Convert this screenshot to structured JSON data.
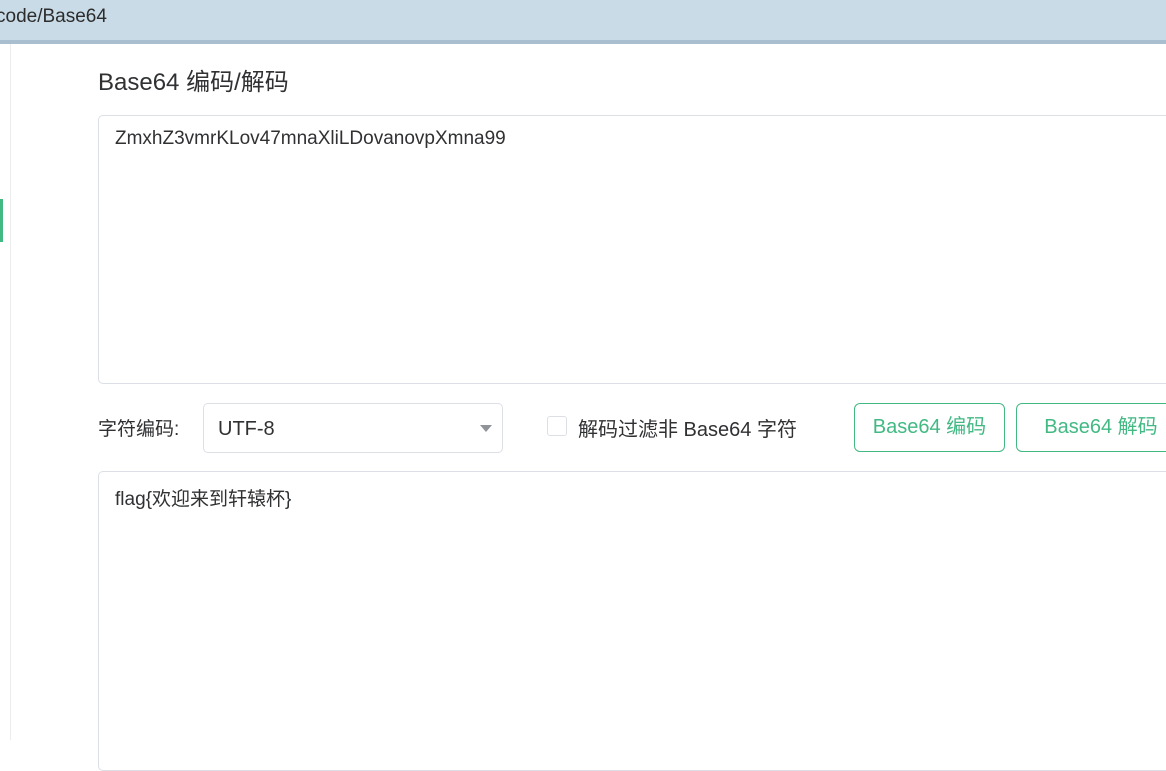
{
  "breadcrumb": {
    "path": "code/Base64"
  },
  "page": {
    "title": "Base64 编码/解码"
  },
  "input": {
    "value": "ZmxhZ3vmrKLov47mnaXliLDovanovpXmna99"
  },
  "options": {
    "charset_label": "字符编码:",
    "charset_value": "UTF-8",
    "filter_label": "解码过滤非 Base64 字符",
    "filter_checked": false
  },
  "buttons": {
    "encode_label": "Base64 编码",
    "decode_label": "Base64 解码"
  },
  "output": {
    "value": "flag{欢迎来到轩辕杯}"
  },
  "colors": {
    "accent": "#42b983",
    "topbar": "#c9dbe7",
    "border": "#dcdfe6"
  },
  "icons": {
    "select_arrow": "chevron-down-icon"
  }
}
